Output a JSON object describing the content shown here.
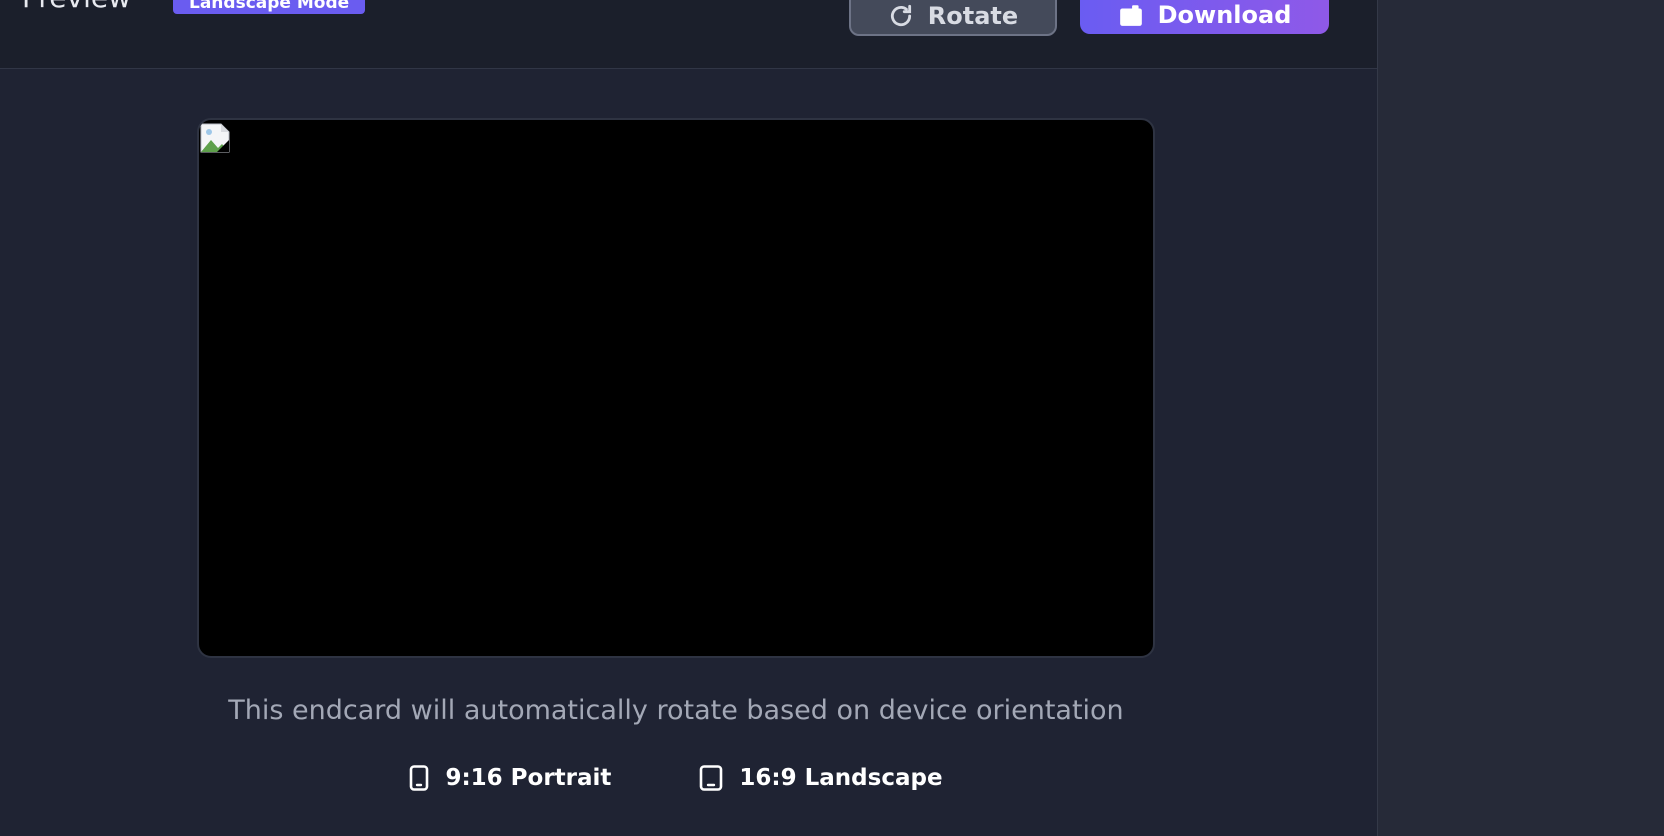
{
  "header": {
    "title": "Preview",
    "mode_badge": "Landscape Mode",
    "rotate_label": "Rotate",
    "download_label": "Download",
    "rotate_icon": "rotate-icon",
    "download_icon": "download-icon"
  },
  "preview": {
    "image_state": "broken-image-icon"
  },
  "caption": "This endcard will automatically rotate based on device orientation",
  "formats": [
    {
      "icon": "phone-icon",
      "label": "9:16 Portrait"
    },
    {
      "icon": "tablet-icon",
      "label": "16:9 Landscape"
    }
  ],
  "colors": {
    "background": "#1f2333",
    "header": "#1b1f2b",
    "accent": "#6a5cf0",
    "accent_gradient_end": "#8f59e8",
    "caption_text": "#a3a8b6"
  }
}
